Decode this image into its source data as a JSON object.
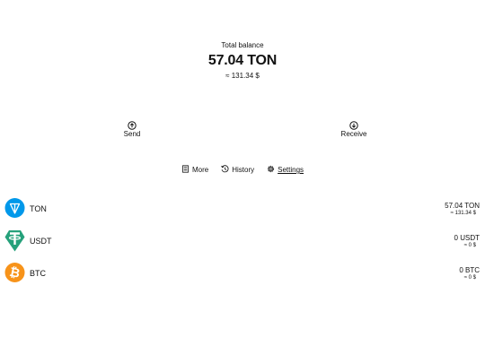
{
  "balance": {
    "title": "Total balance",
    "amount": "57.04 TON",
    "fiat": "≈ 131.34 $"
  },
  "actions": {
    "send_label": "Send",
    "receive_label": "Receive",
    "send_icon": "arrow-up-circle-icon",
    "receive_icon": "arrow-down-circle-icon"
  },
  "links": [
    {
      "label": "More",
      "icon": "document-list-icon"
    },
    {
      "label": "History",
      "icon": "history-icon"
    },
    {
      "label": "Settings",
      "icon": "gear-icon"
    }
  ],
  "assets": [
    {
      "name": "TON",
      "amount": "57.04 TON",
      "fiat": "≈ 131.34 $",
      "icon": "ton-logo-icon",
      "color": "#0098EA"
    },
    {
      "name": "USDT",
      "amount": "0 USDT",
      "fiat": "≈ 0 $",
      "icon": "usdt-logo-icon",
      "color": "#26A17B"
    },
    {
      "name": "BTC",
      "amount": "0 BTC",
      "fiat": "≈ 0 $",
      "icon": "btc-logo-icon",
      "color": "#F7931A"
    }
  ]
}
